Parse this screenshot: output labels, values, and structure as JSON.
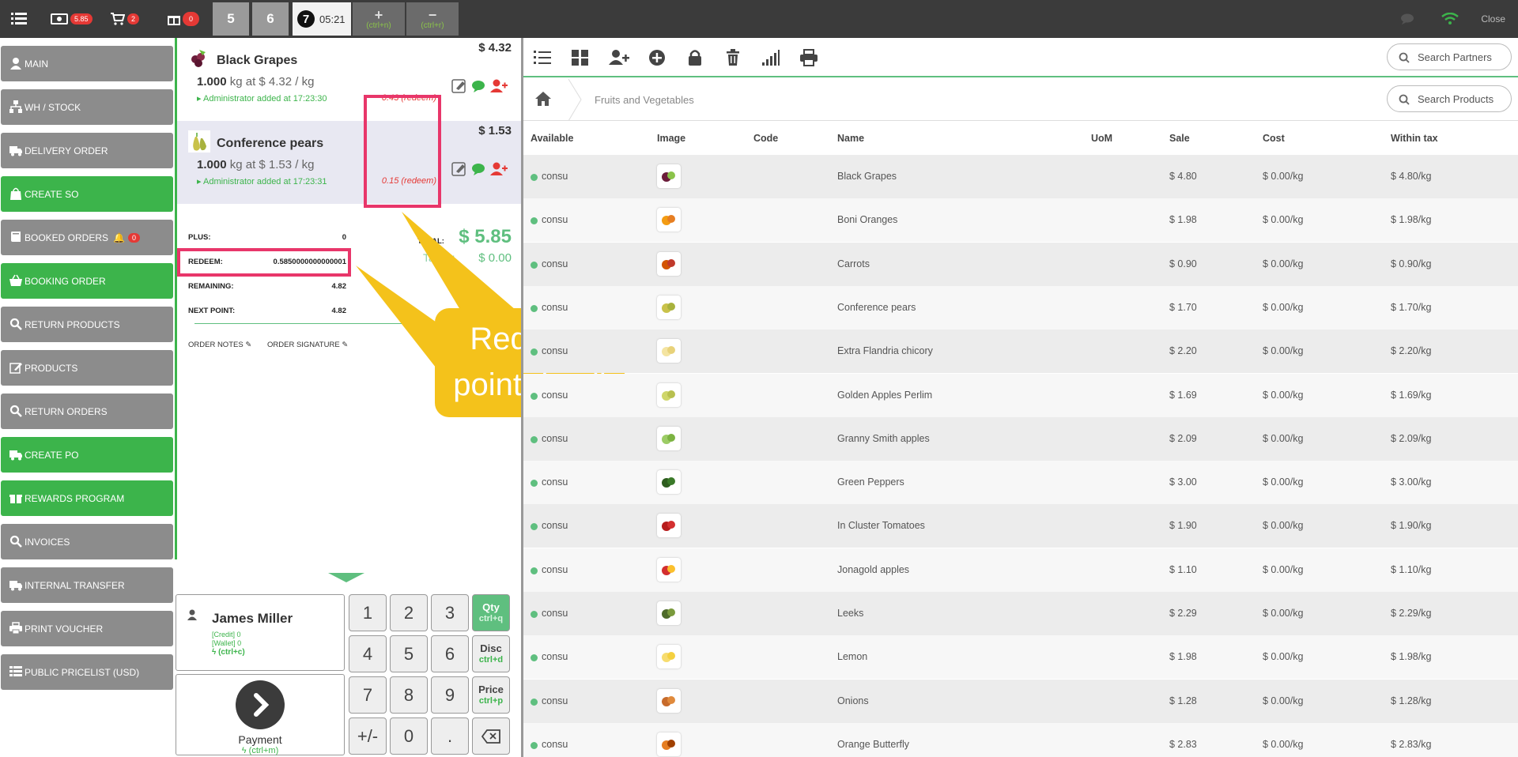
{
  "topbar": {
    "cash_badge": "5.85",
    "cart_badge": "2",
    "gift_badge": "0",
    "orders": [
      "5",
      "6"
    ],
    "active_order": {
      "number": "7",
      "time": "05:21"
    },
    "new_order_shortcut": "(ctrl+n)",
    "remove_order_shortcut": "(ctrl+r)",
    "close_label": "Close"
  },
  "menu": {
    "items": [
      {
        "label": "MAIN",
        "color": "gray",
        "icon": "user-icon"
      },
      {
        "label": "WH / STOCK",
        "color": "gray",
        "icon": "sitemap-icon"
      },
      {
        "label": "DELIVERY ORDER",
        "color": "gray",
        "icon": "truck-icon"
      },
      {
        "label": "CREATE SO",
        "color": "green",
        "icon": "shopping-bag-icon"
      },
      {
        "label": "BOOKED ORDERS",
        "color": "gray",
        "icon": "book-icon",
        "badge": "0"
      },
      {
        "label": "BOOKING ORDER",
        "color": "green",
        "icon": "basket-icon"
      },
      {
        "label": "RETURN PRODUCTS",
        "color": "gray",
        "icon": "search-icon"
      },
      {
        "label": "PRODUCTS",
        "color": "gray",
        "icon": "edit-icon"
      },
      {
        "label": "RETURN ORDERS",
        "color": "gray",
        "icon": "search-icon"
      },
      {
        "label": "CREATE PO",
        "color": "green",
        "icon": "truck-icon"
      },
      {
        "label": "REWARDS PROGRAM",
        "color": "green",
        "icon": "gift-icon"
      },
      {
        "label": "INVOICES",
        "color": "gray",
        "icon": "search-icon"
      },
      {
        "label": "INTERNAL TRANSFER",
        "color": "gray",
        "icon": "truck-icon"
      },
      {
        "label": "PRINT VOUCHER",
        "color": "gray",
        "icon": "print-icon"
      },
      {
        "label": "PUBLIC PRICELIST (USD)",
        "color": "gray",
        "icon": "list-icon"
      }
    ]
  },
  "order": {
    "lines": [
      {
        "name": "Black Grapes",
        "price": "$ 4.32",
        "qty": "1.000",
        "qty_detail": "kg at $ 4.32 / kg",
        "added_by": "Administrator added at 17:23:30",
        "redeem": "0.43 (redeem)"
      },
      {
        "name": "Conference pears",
        "price": "$ 1.53",
        "qty": "1.000",
        "qty_detail": "kg at $ 1.53 / kg",
        "added_by": "Administrator added at 17:23:31",
        "redeem": "0.15 (redeem)"
      }
    ],
    "summary": {
      "plus_label": "PLUS:",
      "plus_value": "0",
      "redeem_label": "REDEEM:",
      "redeem_value": "0.5850000000000001",
      "remaining_label": "REMAINING:",
      "remaining_value": "4.82",
      "next_point_label": "NEXT POINT:",
      "next_point_value": "4.82",
      "total_label": "TOTAL:",
      "total_value": "$ 5.85",
      "taxes_label": "Taxes:",
      "taxes_value": "$ 0.00"
    },
    "order_notes_label": "ORDER NOTES",
    "order_signature_label": "ORDER SIGNATURE"
  },
  "callout": {
    "line1": "Redeem",
    "line2": "point detail",
    "color": "#f4c21b"
  },
  "customer": {
    "name": "James Miller",
    "credit": "[Credit] 0",
    "wallet": "[Wallet] 0",
    "shortcut": "(ctrl+c)"
  },
  "payment": {
    "label": "Payment",
    "shortcut": "(ctrl+m)"
  },
  "numpad": {
    "keys": [
      "1",
      "2",
      "3",
      "4",
      "5",
      "6",
      "7",
      "8",
      "9",
      "+/-",
      "0",
      "."
    ],
    "qty": {
      "label": "Qty",
      "shortcut": "ctrl+q"
    },
    "disc": {
      "label": "Disc",
      "shortcut": "ctrl+d"
    },
    "price": {
      "label": "Price",
      "shortcut": "ctrl+p"
    }
  },
  "products": {
    "search_partners_placeholder": "Search Partners",
    "search_products_placeholder": "Search Products",
    "category": "Fruits and Vegetables",
    "columns": [
      "Available",
      "Image",
      "Code",
      "Name",
      "UoM",
      "Sale",
      "Cost",
      "Within tax"
    ],
    "rows": [
      {
        "available": "consu",
        "code": "",
        "name": "Black Grapes",
        "uom": "",
        "sale": "$ 4.80",
        "cost": "$ 0.00/kg",
        "within_tax": "$ 4.80/kg"
      },
      {
        "available": "consu",
        "code": "",
        "name": "Boni Oranges",
        "uom": "",
        "sale": "$ 1.98",
        "cost": "$ 0.00/kg",
        "within_tax": "$ 1.98/kg"
      },
      {
        "available": "consu",
        "code": "",
        "name": "Carrots",
        "uom": "",
        "sale": "$ 0.90",
        "cost": "$ 0.00/kg",
        "within_tax": "$ 0.90/kg"
      },
      {
        "available": "consu",
        "code": "",
        "name": "Conference pears",
        "uom": "",
        "sale": "$ 1.70",
        "cost": "$ 0.00/kg",
        "within_tax": "$ 1.70/kg"
      },
      {
        "available": "consu",
        "code": "",
        "name": "Extra Flandria chicory",
        "uom": "",
        "sale": "$ 2.20",
        "cost": "$ 0.00/kg",
        "within_tax": "$ 2.20/kg"
      },
      {
        "available": "consu",
        "code": "",
        "name": "Golden Apples Perlim",
        "uom": "",
        "sale": "$ 1.69",
        "cost": "$ 0.00/kg",
        "within_tax": "$ 1.69/kg"
      },
      {
        "available": "consu",
        "code": "",
        "name": "Granny Smith apples",
        "uom": "",
        "sale": "$ 2.09",
        "cost": "$ 0.00/kg",
        "within_tax": "$ 2.09/kg"
      },
      {
        "available": "consu",
        "code": "",
        "name": "Green Peppers",
        "uom": "",
        "sale": "$ 3.00",
        "cost": "$ 0.00/kg",
        "within_tax": "$ 3.00/kg"
      },
      {
        "available": "consu",
        "code": "",
        "name": "In Cluster Tomatoes",
        "uom": "",
        "sale": "$ 1.90",
        "cost": "$ 0.00/kg",
        "within_tax": "$ 1.90/kg"
      },
      {
        "available": "consu",
        "code": "",
        "name": "Jonagold apples",
        "uom": "",
        "sale": "$ 1.10",
        "cost": "$ 0.00/kg",
        "within_tax": "$ 1.10/kg"
      },
      {
        "available": "consu",
        "code": "",
        "name": "Leeks",
        "uom": "",
        "sale": "$ 2.29",
        "cost": "$ 0.00/kg",
        "within_tax": "$ 2.29/kg"
      },
      {
        "available": "consu",
        "code": "",
        "name": "Lemon",
        "uom": "",
        "sale": "$ 1.98",
        "cost": "$ 0.00/kg",
        "within_tax": "$ 1.98/kg"
      },
      {
        "available": "consu",
        "code": "",
        "name": "Onions",
        "uom": "",
        "sale": "$ 1.28",
        "cost": "$ 0.00/kg",
        "within_tax": "$ 1.28/kg"
      },
      {
        "available": "consu",
        "code": "",
        "name": "Orange Butterfly",
        "uom": "",
        "sale": "$ 2.83",
        "cost": "$ 0.00/kg",
        "within_tax": "$ 2.83/kg"
      }
    ]
  },
  "colors": {
    "green": "#3cb44b",
    "gray": "#8c8c8c",
    "highlight": "#e8366a",
    "dark": "#3b3b3b"
  }
}
